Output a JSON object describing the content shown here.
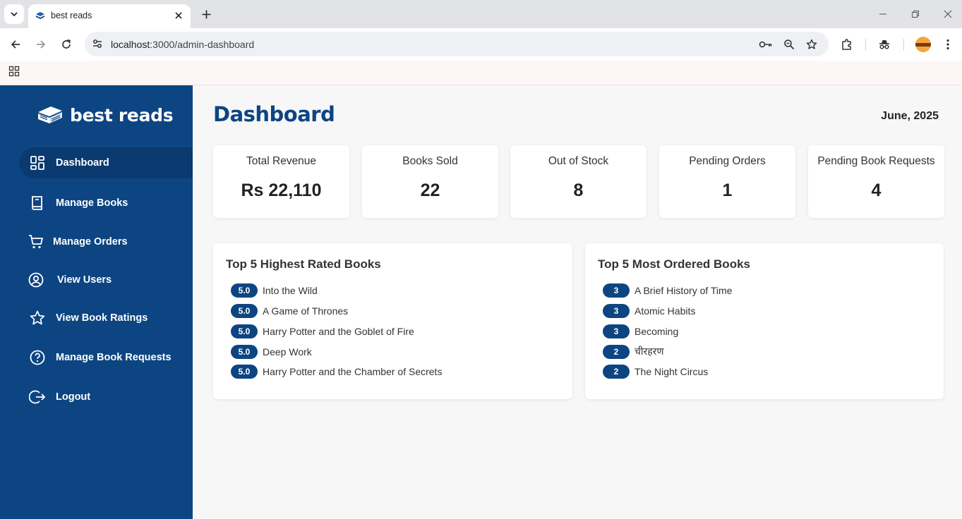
{
  "browser": {
    "tab_title": "best reads",
    "url_host": "localhost",
    "url_path": ":3000/admin-dashboard"
  },
  "sidebar": {
    "brand": "best reads",
    "items": [
      {
        "label": "Dashboard",
        "icon": "dashboard-grid-icon",
        "active": true
      },
      {
        "label": "Manage Books",
        "icon": "book-icon"
      },
      {
        "label": "Manage Orders",
        "icon": "cart-icon"
      },
      {
        "label": "View Users",
        "icon": "user-circle-icon"
      },
      {
        "label": "View Book Ratings",
        "icon": "star-icon"
      },
      {
        "label": "Manage Book Requests",
        "icon": "help-circle-icon"
      },
      {
        "label": "Logout",
        "icon": "logout-icon"
      }
    ]
  },
  "main": {
    "title": "Dashboard",
    "date": "June, 2025",
    "stats": [
      {
        "label": "Total Revenue",
        "value": "Rs 22,110"
      },
      {
        "label": "Books Sold",
        "value": "22"
      },
      {
        "label": "Out of Stock",
        "value": "8"
      },
      {
        "label": "Pending Orders",
        "value": "1"
      },
      {
        "label": "Pending Book Requests",
        "value": "4"
      }
    ],
    "top_rated": {
      "title": "Top 5 Highest Rated Books",
      "items": [
        {
          "badge": "5.0",
          "title": "Into the Wild"
        },
        {
          "badge": "5.0",
          "title": "A Game of Thrones"
        },
        {
          "badge": "5.0",
          "title": "Harry Potter and the Goblet of Fire"
        },
        {
          "badge": "5.0",
          "title": "Deep Work"
        },
        {
          "badge": "5.0",
          "title": "Harry Potter and the Chamber of Secrets"
        }
      ]
    },
    "most_ordered": {
      "title": "Top 5 Most Ordered Books",
      "items": [
        {
          "badge": "3",
          "title": "A Brief History of Time"
        },
        {
          "badge": "3",
          "title": "Atomic Habits"
        },
        {
          "badge": "3",
          "title": "Becoming"
        },
        {
          "badge": "2",
          "title": "चीरहरण"
        },
        {
          "badge": "2",
          "title": "The Night Circus"
        }
      ]
    }
  },
  "colors": {
    "primary": "#0d4582",
    "active_nav": "#0a3a6f",
    "background": "#f7f7f8"
  }
}
